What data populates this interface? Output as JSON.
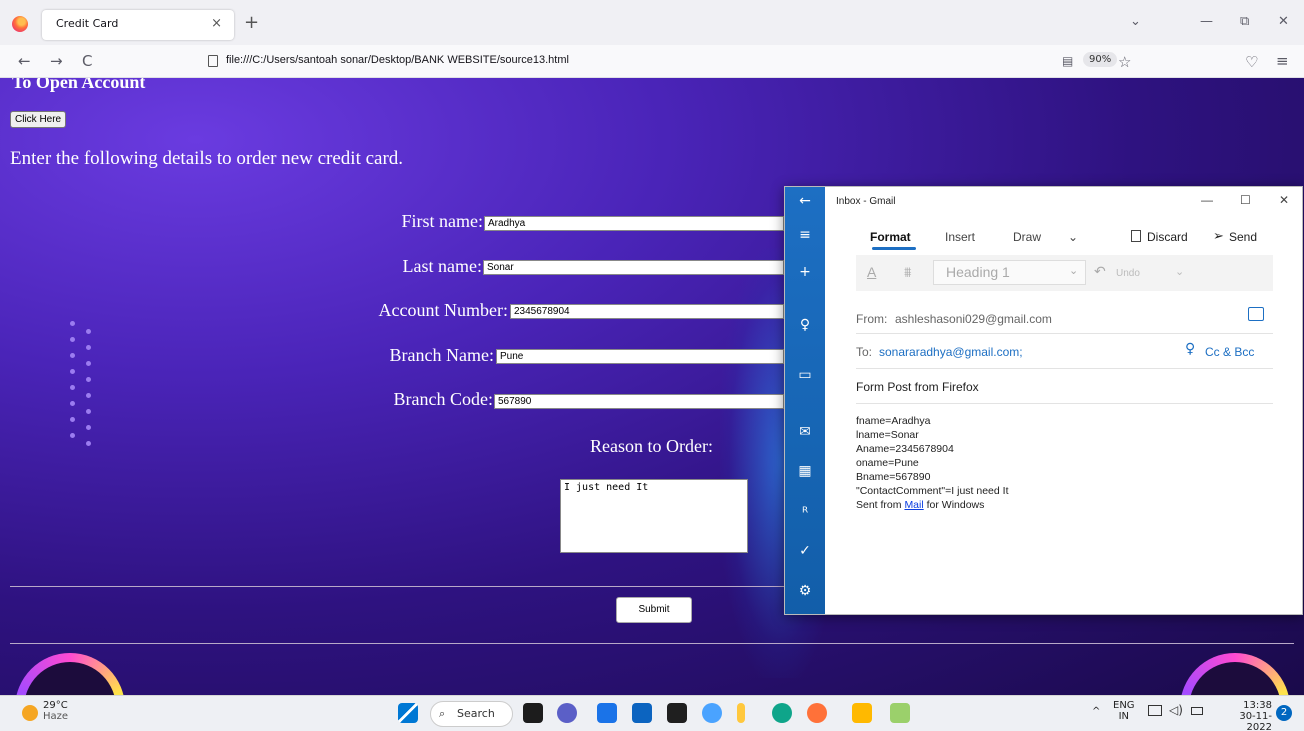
{
  "browser": {
    "tab_title": "Credit Card",
    "tab_close": "×",
    "new_tab": "+",
    "url": "file:///C:/Users/santoah sonar/Desktop/BANK WEBSITE/source13.html",
    "zoom": "90%",
    "nav_back": "←",
    "nav_forward": "→",
    "nav_reload": "C",
    "win_chevron": "⌄",
    "win_min": "—",
    "win_restore": "⧉",
    "win_close": "✕",
    "reader_icon": "▤",
    "star_icon": "☆",
    "pocket_icon": "♡",
    "menu_icon": "≡"
  },
  "page": {
    "heading": "To Open Account",
    "click_button": "Click Here",
    "intro": "Enter the following details to order new credit card.",
    "fields": [
      {
        "label": "First name:",
        "value": "Aradhya"
      },
      {
        "label": "Last name:",
        "value": "Sonar"
      },
      {
        "label": "Account Number:",
        "value": "2345678904"
      },
      {
        "label": "Branch Name:",
        "value": "Pune"
      },
      {
        "label": "Branch Code:",
        "value": "567890"
      }
    ],
    "reason_label": "Reason to Order:",
    "reason_value": "I just need It",
    "submit": "Submit"
  },
  "mail": {
    "title": "Inbox - Gmail",
    "ctl_min": "—",
    "ctl_max": "☐",
    "ctl_close": "✕",
    "tabs": [
      "Format",
      "Insert",
      "Draw",
      "⌄"
    ],
    "discard": "Discard",
    "send": "Send",
    "font_color_btn": "A",
    "para_btn": "⩩",
    "heading_style": "Heading 1",
    "heading_chevron": "⌄",
    "undo": "Undo",
    "undo_chevron": "⌄",
    "from_label": "From:",
    "from": "ashleshasoni029@gmail.com",
    "to_label": "To:",
    "to": "sonararadhya@gmail.com;",
    "cc": "Cc & Bcc",
    "subject": "Form Post from Firefox",
    "body_lines": [
      "fname=Aradhya",
      "lname=Sonar",
      "Aname=2345678904",
      "oname=Pune",
      "Bname=567890",
      "\"ContactComment\"=I just need It"
    ],
    "sent_prefix": "Sent from ",
    "sent_link": "Mail",
    "sent_suffix": " for Windows",
    "rail_icons": [
      "←",
      "≡",
      "+",
      "♀",
      "▭",
      "✉",
      "▦",
      "ᴿ",
      "✓",
      "⚙"
    ]
  },
  "taskbar": {
    "temp": "29°C",
    "weather": "Haze",
    "search": "Search",
    "tray_chevron": "^",
    "lang": "ENG",
    "lang2": "IN",
    "time": "13:38",
    "date": "30-11-2022",
    "notif": "2"
  }
}
